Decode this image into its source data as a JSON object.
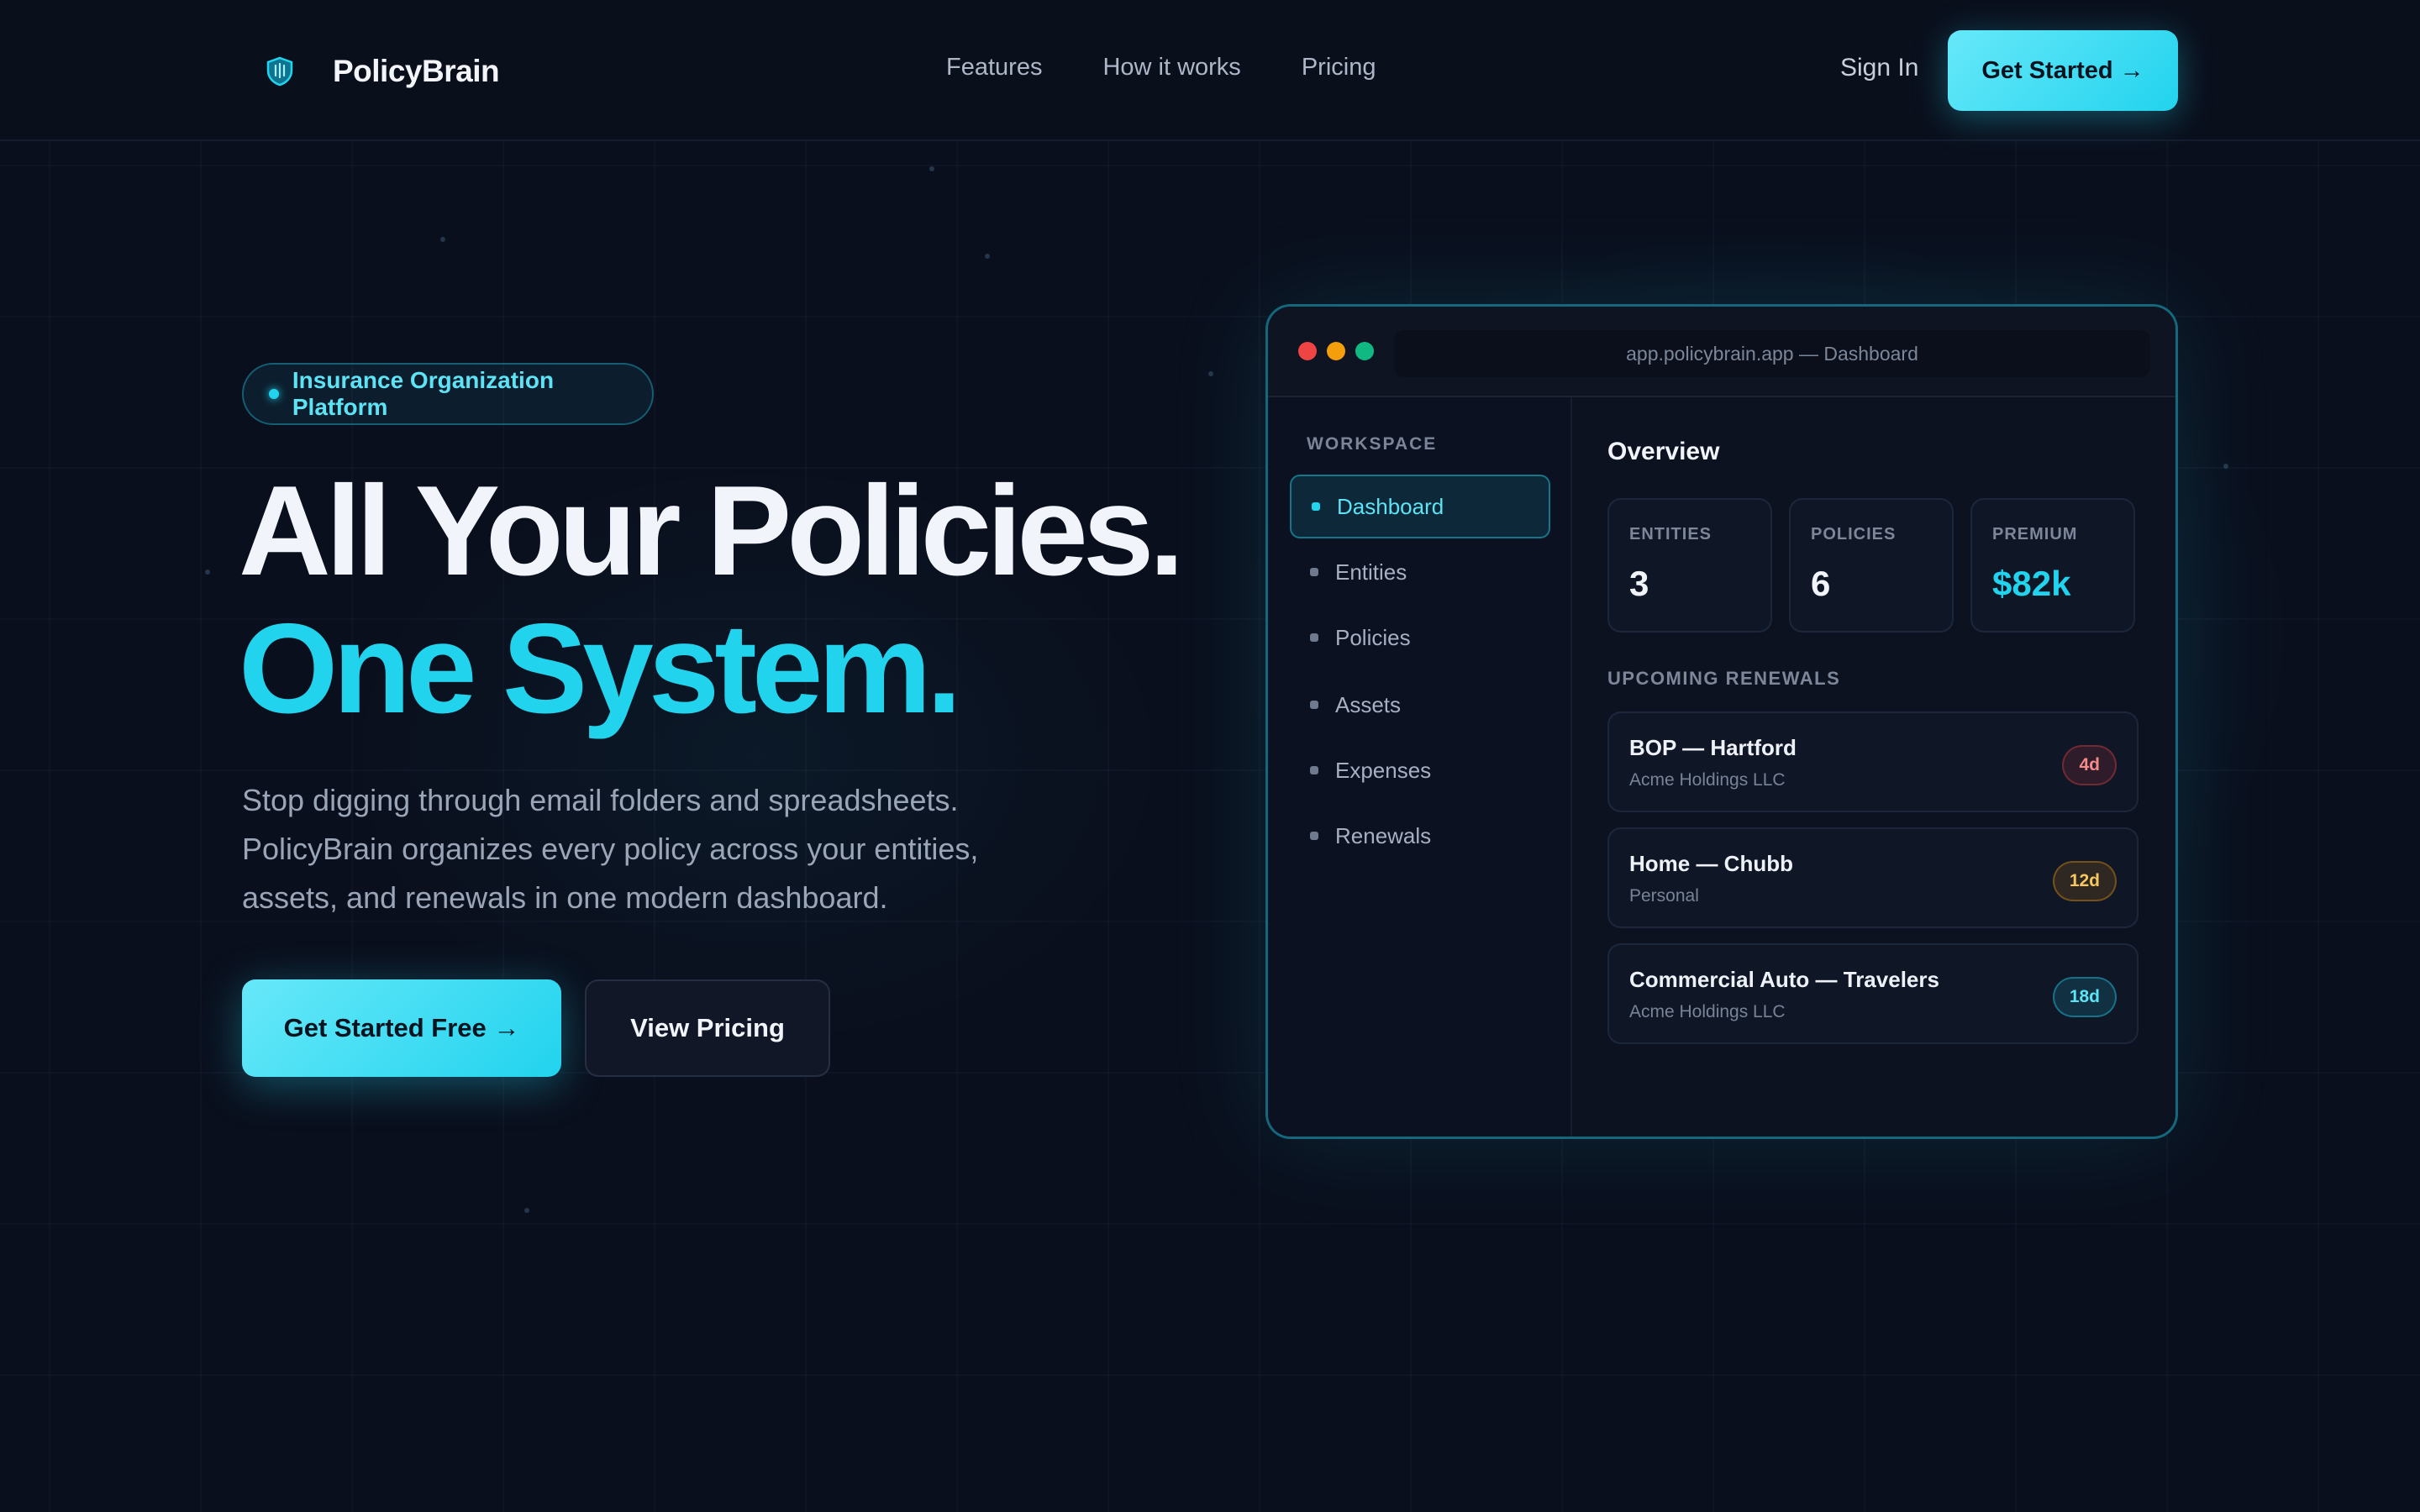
{
  "nav": {
    "brand": "PolicyBrain",
    "logo_icon": "shield-icon",
    "links": [
      "Features",
      "How it works",
      "Pricing"
    ],
    "sign_in": "Sign In",
    "cta": "Get Started →"
  },
  "hero": {
    "badge": "Insurance Organization Platform",
    "headline_1": "All Your Policies.",
    "headline_2": "One System.",
    "lead": "Stop digging through email folders and spreadsheets. PolicyBrain organizes every policy across your entities, assets, and renewals in one modern dashboard.",
    "primary_cta": "Get Started Free →",
    "secondary_cta": "View Pricing"
  },
  "app": {
    "url": "app.policybrain.app — Dashboard",
    "workspace_label": "WORKSPACE",
    "sidebar": [
      {
        "label": "Dashboard",
        "active": true
      },
      {
        "label": "Entities",
        "active": false
      },
      {
        "label": "Policies",
        "active": false
      },
      {
        "label": "Assets",
        "active": false
      },
      {
        "label": "Expenses",
        "active": false
      },
      {
        "label": "Renewals",
        "active": false
      }
    ],
    "overview_title": "Overview",
    "stats": [
      {
        "label": "ENTITIES",
        "value": "3"
      },
      {
        "label": "POLICIES",
        "value": "6"
      },
      {
        "label": "PREMIUM",
        "value": "$82k"
      }
    ],
    "renewals_label": "UPCOMING RENEWALS",
    "renewals": [
      {
        "title": "BOP — Hartford",
        "subtitle": "Acme Holdings LLC",
        "due": "4d"
      },
      {
        "title": "Home — Chubb",
        "subtitle": "Personal",
        "due": "12d"
      },
      {
        "title": "Commercial Auto — Travelers",
        "subtitle": "Acme Holdings LLC",
        "due": "18d"
      }
    ]
  },
  "colors": {
    "accent": "#22d3ee",
    "background": "#0a0f1d",
    "traffic_red": "#ef4444",
    "traffic_yellow": "#f59e0b",
    "traffic_green": "#10b981",
    "urgent": "#ef4444",
    "soon": "#f59e0b",
    "later": "#22d3ee"
  }
}
